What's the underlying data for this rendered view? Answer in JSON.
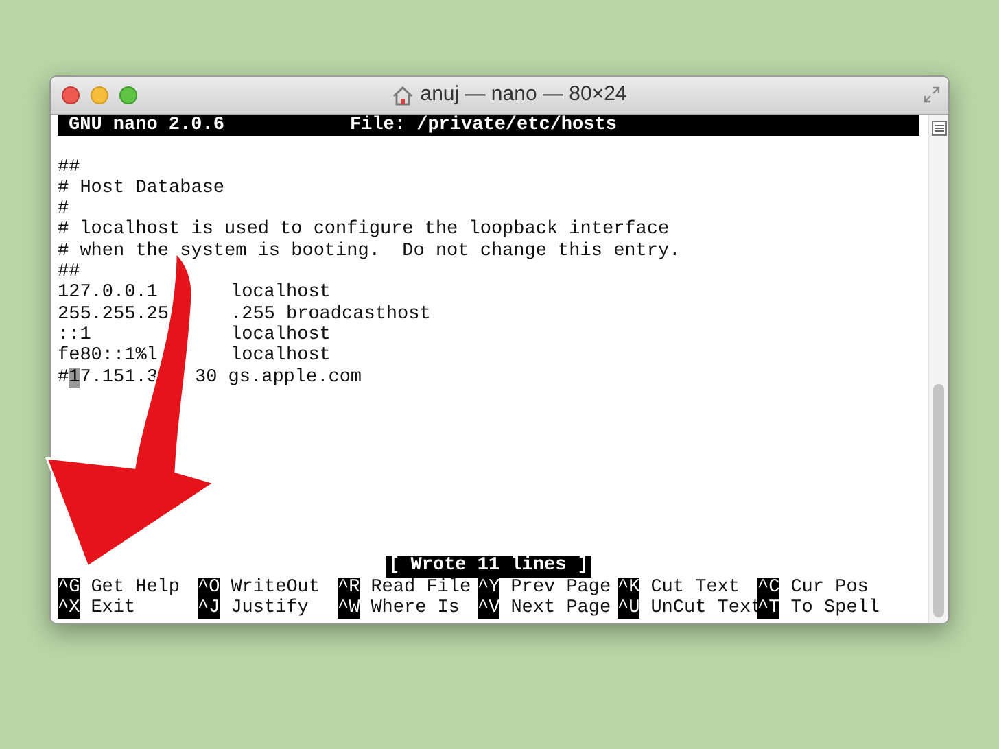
{
  "window": {
    "title": "anuj — nano — 80×24"
  },
  "nano": {
    "version": "GNU nano 2.0.6",
    "file": "File: /private/etc/hosts"
  },
  "lines": [
    {
      "text": "##"
    },
    {
      "text": "# Host Database"
    },
    {
      "text": "#"
    },
    {
      "text": "# localhost is used to configure the loopback interface"
    },
    {
      "text": "# when the system is booting.  Do not change this entry."
    },
    {
      "text": "##"
    },
    {
      "text": "127.0.0.1",
      "right": "localhost"
    },
    {
      "text": "255.255.25",
      "right": ".255 broadcasthost"
    },
    {
      "text": "::1",
      "right": "localhost"
    },
    {
      "text": "fe80::1%l",
      "right": "localhost"
    },
    {
      "text": "#",
      "cursor": "1",
      "rest": "7.151.3",
      "right": "30 gs.apple.com"
    }
  ],
  "status": "[ Wrote 11 lines ]",
  "shortcuts": [
    [
      {
        "key": "^G",
        "label": "Get Help"
      },
      {
        "key": "^O",
        "label": "WriteOut"
      },
      {
        "key": "^R",
        "label": "Read File"
      },
      {
        "key": "^Y",
        "label": "Prev Page"
      },
      {
        "key": "^K",
        "label": "Cut Text"
      },
      {
        "key": "^C",
        "label": "Cur Pos"
      }
    ],
    [
      {
        "key": "^X",
        "label": "Exit"
      },
      {
        "key": "^J",
        "label": "Justify"
      },
      {
        "key": "^W",
        "label": "Where Is"
      },
      {
        "key": "^V",
        "label": "Next Page"
      },
      {
        "key": "^U",
        "label": "UnCut Text"
      },
      {
        "key": "^T",
        "label": "To Spell"
      }
    ]
  ]
}
